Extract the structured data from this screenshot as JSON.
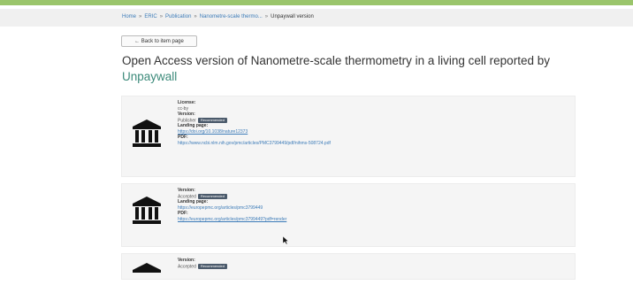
{
  "breadcrumb": {
    "items": [
      "Home",
      "ERIC",
      "Publication",
      "Nanometre-scale thermo..."
    ],
    "current": "Unpaywall version"
  },
  "back_button": {
    "label": "← Back to item page"
  },
  "title": {
    "text": "Open Access version of Nanometre-scale thermometry in a living cell reported by",
    "brand": "Unpaywall"
  },
  "cards": [
    {
      "icon": "bank-icon",
      "license_label": "License:",
      "license_value": "cc-by",
      "version_label": "Version:",
      "version_value": "Publisher",
      "version_badge": "Recommended",
      "landing_label": "Landing page:",
      "landing_url": "https://doi.org/10.1038/nature12373",
      "pdf_label": "PDF:",
      "pdf_url": "https://www.ncbi.nlm.nih.gov/pmc/articles/PMC3799449/pdf/nihms-508724.pdf"
    },
    {
      "icon": "bank-icon",
      "version_label": "Version:",
      "version_value": "Accepted",
      "version_badge": "Recommended",
      "landing_label": "Landing page:",
      "landing_url": "https://europepmc.org/articles/pmc3799449",
      "pdf_label": "PDF:",
      "pdf_url": "https://europepmc.org/articles/pmc3799449?pdf=render"
    },
    {
      "icon": "bank-icon",
      "version_label": "Version:",
      "version_value": "Accepted",
      "version_badge": "Recommended"
    }
  ],
  "colors": {
    "accent": "#9ac56b",
    "link": "#3c7bb8",
    "brand": "#3c8a7a",
    "badge": "#4b5a6b"
  }
}
